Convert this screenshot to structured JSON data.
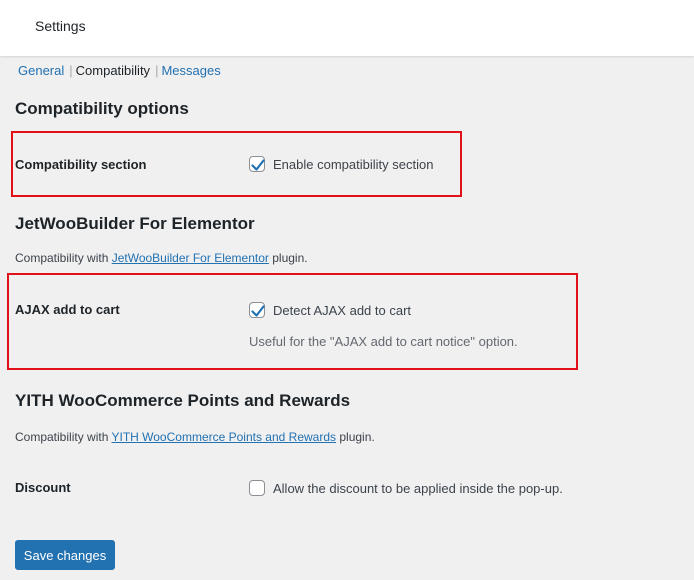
{
  "header": {
    "title": "Settings"
  },
  "subnav": {
    "items": [
      {
        "label": "General",
        "current": false
      },
      {
        "label": "Compatibility",
        "current": true
      },
      {
        "label": "Messages",
        "current": false
      }
    ],
    "separator": "|"
  },
  "compat_options": {
    "heading": "Compatibility options",
    "row_label": "Compatibility section",
    "checkbox_label": "Enable compatibility section",
    "checked": true
  },
  "jetwoo": {
    "heading": "JetWooBuilder For Elementor",
    "desc_prefix": "Compatibility with ",
    "desc_link": "JetWooBuilder For Elementor",
    "desc_suffix": " plugin.",
    "row_label": "AJAX add to cart",
    "checkbox_label": "Detect AJAX add to cart",
    "checked": true,
    "help": "Useful for the \"AJAX add to cart notice\" option."
  },
  "yith": {
    "heading": "YITH WooCommerce Points and Rewards",
    "desc_prefix": "Compatibility with ",
    "desc_link": "YITH WooCommerce Points and Rewards",
    "desc_suffix": " plugin.",
    "row_label": "Discount",
    "checkbox_label": "Allow the discount to be applied inside the pop-up.",
    "checked": false
  },
  "save_label": "Save changes",
  "colors": {
    "accent": "#2271b1",
    "highlight_box": "#e2101b",
    "background": "#f0f0f1"
  }
}
